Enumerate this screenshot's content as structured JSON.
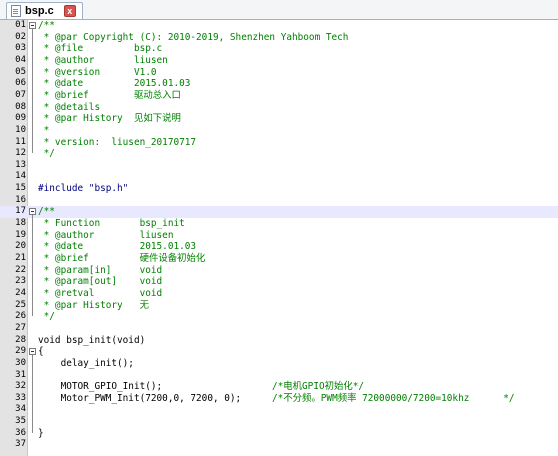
{
  "tab": {
    "filename": "bsp.c",
    "close_glyph": "x"
  },
  "lines": [
    {
      "n": "01",
      "text": "/**"
    },
    {
      "n": "02",
      "text": " * @par Copyright (C): 2010-2019, Shenzhen Yahboom Tech"
    },
    {
      "n": "03",
      "text": " * @file         bsp.c"
    },
    {
      "n": "04",
      "text": " * @author       liusen"
    },
    {
      "n": "05",
      "text": " * @version      V1.0"
    },
    {
      "n": "06",
      "text": " * @date         2015.01.03"
    },
    {
      "n": "07",
      "text": " * @brief        驱动总入口"
    },
    {
      "n": "08",
      "text": " * @details"
    },
    {
      "n": "09",
      "text": " * @par History  见如下说明"
    },
    {
      "n": "10",
      "text": " *"
    },
    {
      "n": "11",
      "text": " * version:  liusen_20170717"
    },
    {
      "n": "12",
      "text": " */"
    },
    {
      "n": "13",
      "text": ""
    },
    {
      "n": "14",
      "text": ""
    },
    {
      "n": "15",
      "text": "#include \"bsp.h\""
    },
    {
      "n": "16",
      "text": ""
    },
    {
      "n": "17",
      "text": "/**"
    },
    {
      "n": "18",
      "text": " * Function       bsp_init"
    },
    {
      "n": "19",
      "text": " * @author        liusen"
    },
    {
      "n": "20",
      "text": " * @date          2015.01.03"
    },
    {
      "n": "21",
      "text": " * @brief         硬件设备初始化"
    },
    {
      "n": "22",
      "text": " * @param[in]     void"
    },
    {
      "n": "23",
      "text": " * @param[out]    void"
    },
    {
      "n": "24",
      "text": " * @retval        void"
    },
    {
      "n": "25",
      "text": " * @par History   无"
    },
    {
      "n": "26",
      "text": " */"
    },
    {
      "n": "27",
      "text": ""
    },
    {
      "n": "28",
      "text": "void bsp_init(void)"
    },
    {
      "n": "29",
      "text": "{"
    },
    {
      "n": "30",
      "text": "    delay_init();"
    },
    {
      "n": "31",
      "text": ""
    },
    {
      "n": "32",
      "text": "    MOTOR_GPIO_Init();",
      "comment": "/*电机GPIO初始化*/"
    },
    {
      "n": "33",
      "text": "    Motor_PWM_Init(7200,0, 7200, 0);",
      "comment": "/*不分频。PWM频率 72000000/7200=10khz      */"
    },
    {
      "n": "34",
      "text": ""
    },
    {
      "n": "35",
      "text": ""
    },
    {
      "n": "36",
      "text": "}"
    },
    {
      "n": "37",
      "text": ""
    }
  ],
  "colors": {
    "comment": "#008000",
    "keyword": "#000080",
    "highlight_line": "#e8e8ff",
    "gutter": "#e3e3e3"
  },
  "icons": [
    "file-icon",
    "close-icon",
    "fold-toggle-icon"
  ]
}
